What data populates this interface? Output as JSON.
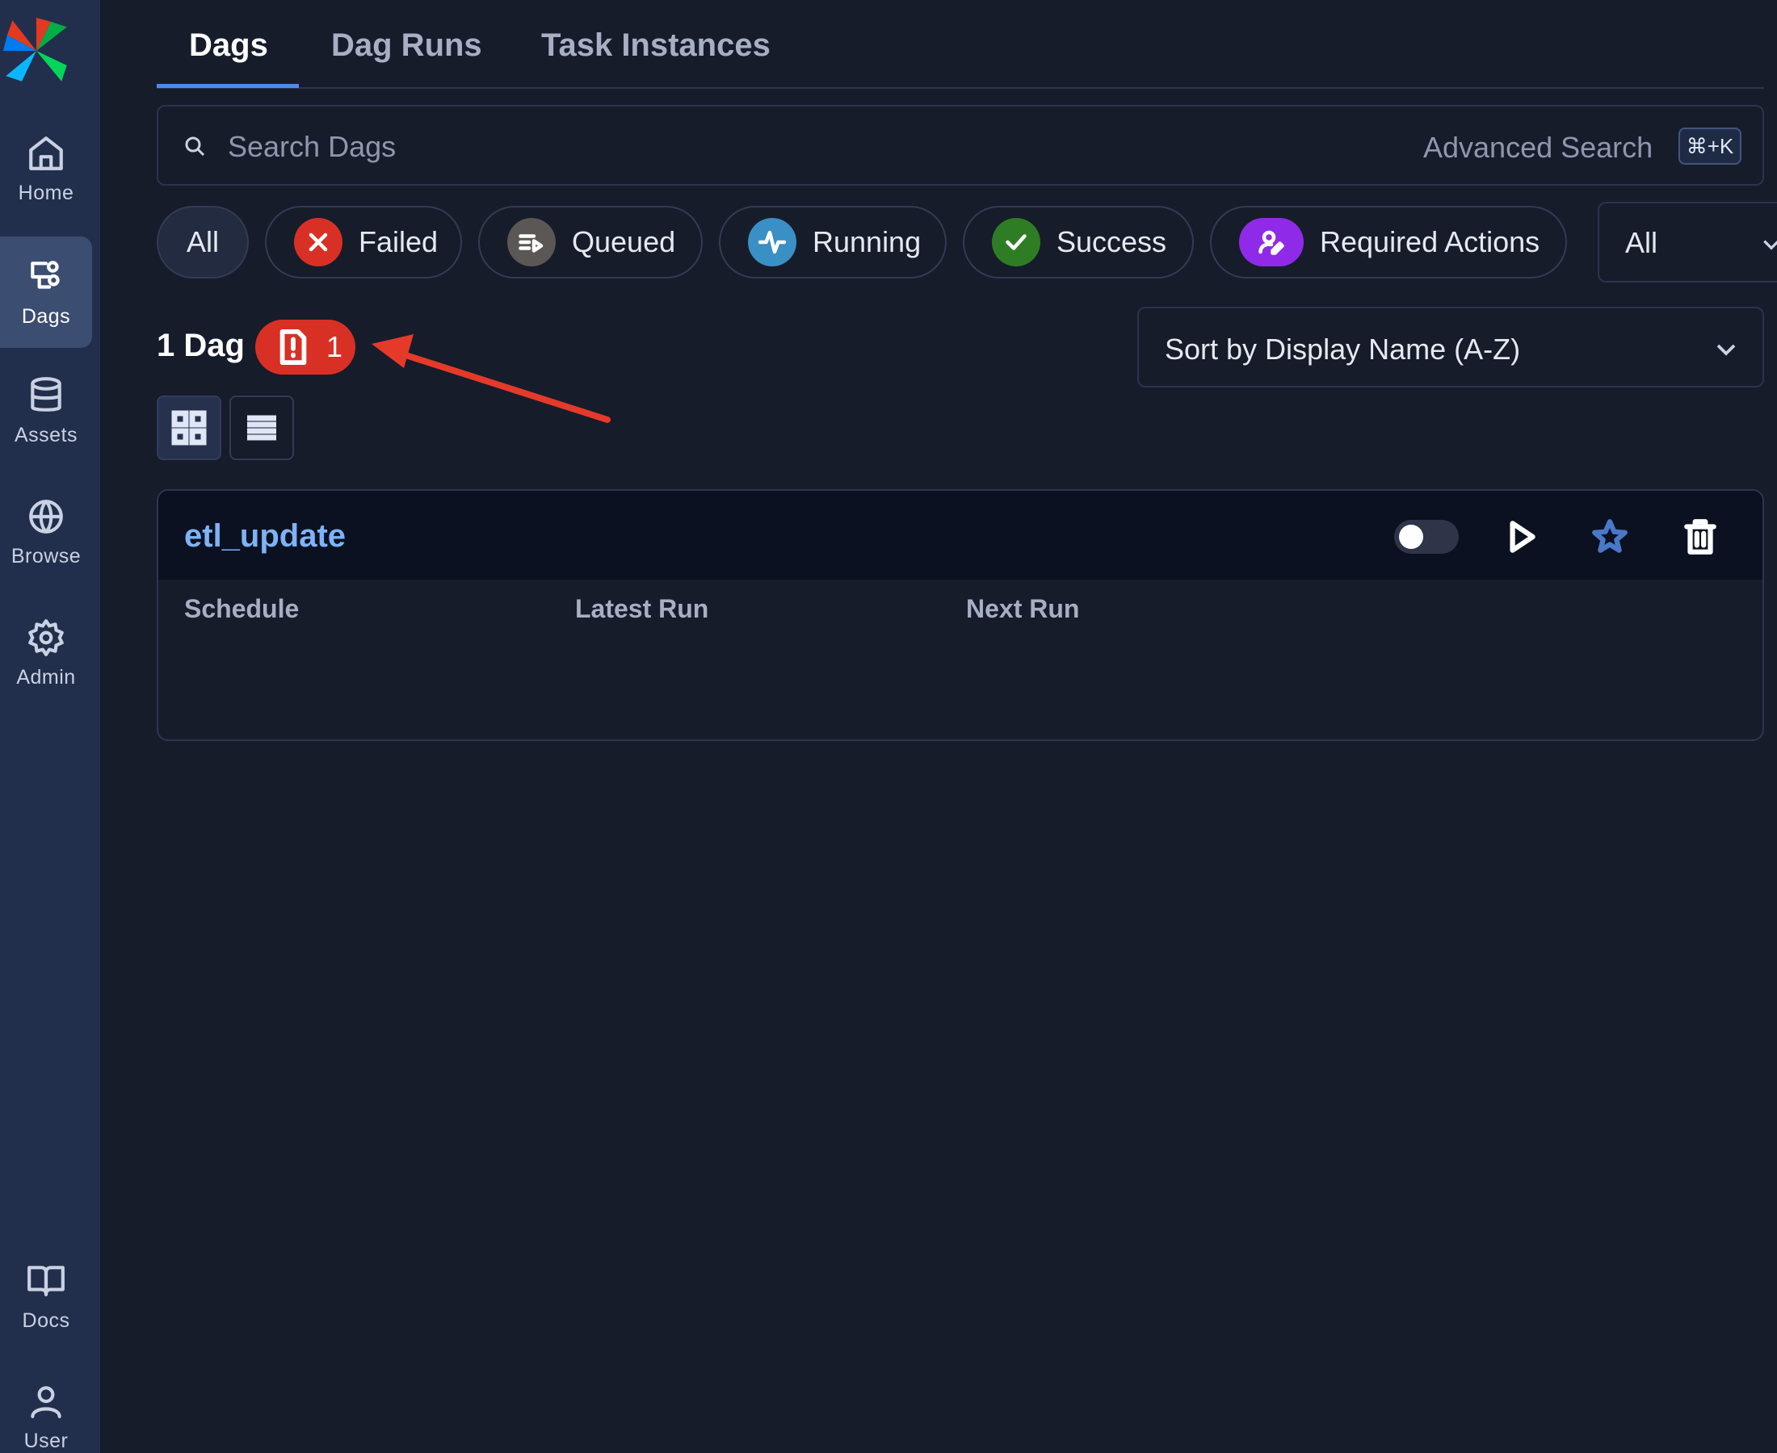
{
  "sidebar": {
    "items": [
      {
        "label": "Home",
        "icon": "home-icon"
      },
      {
        "label": "Dags",
        "icon": "dags-icon",
        "active": true
      },
      {
        "label": "Assets",
        "icon": "database-icon"
      },
      {
        "label": "Browse",
        "icon": "globe-icon"
      },
      {
        "label": "Admin",
        "icon": "gear-icon"
      },
      {
        "label": "Docs",
        "icon": "book-icon"
      },
      {
        "label": "User",
        "icon": "user-icon"
      }
    ]
  },
  "tabs": [
    {
      "label": "Dags",
      "active": true
    },
    {
      "label": "Dag Runs"
    },
    {
      "label": "Task Instances"
    }
  ],
  "search": {
    "placeholder": "Search Dags",
    "advanced_label": "Advanced Search",
    "shortcut": "⌘+K"
  },
  "filters": {
    "all": "All",
    "failed": "Failed",
    "queued": "Queued",
    "running": "Running",
    "success": "Success",
    "required_actions": "Required Actions",
    "select_value": "All"
  },
  "colors": {
    "failed": "#d93025",
    "queued": "#5b5754",
    "running": "#3a8fc4",
    "success": "#2e7d24",
    "required_actions": "#8f2be8",
    "accent": "#4b8cf0"
  },
  "summary": {
    "count_label": "1 Dag",
    "import_errors": "1"
  },
  "sort": {
    "label": "Sort by Display Name (A-Z)"
  },
  "dag_card": {
    "name": "etl_update",
    "paused": true,
    "columns": [
      "Schedule",
      "Latest Run",
      "Next Run"
    ]
  }
}
